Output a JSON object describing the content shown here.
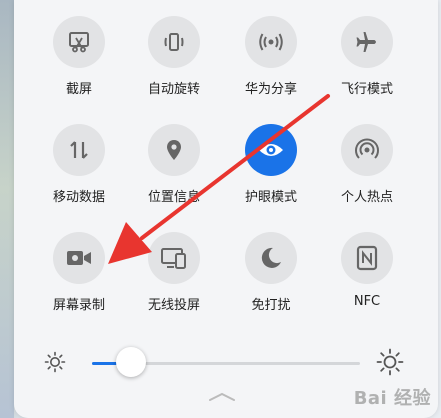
{
  "tiles": [
    {
      "label": "截屏",
      "icon": "screenshot-icon"
    },
    {
      "label": "自动旋转",
      "icon": "auto-rotate-icon"
    },
    {
      "label": "华为分享",
      "icon": "huawei-share-icon"
    },
    {
      "label": "飞行模式",
      "icon": "airplane-icon"
    },
    {
      "label": "移动数据",
      "icon": "mobile-data-icon"
    },
    {
      "label": "位置信息",
      "icon": "location-icon"
    },
    {
      "label": "护眼模式",
      "icon": "eye-comfort-icon",
      "active": true
    },
    {
      "label": "个人热点",
      "icon": "hotspot-icon"
    },
    {
      "label": "屏幕录制",
      "icon": "screen-record-icon"
    },
    {
      "label": "无线投屏",
      "icon": "wireless-projection-icon"
    },
    {
      "label": "免打扰",
      "icon": "do-not-disturb-icon"
    },
    {
      "label": "NFC",
      "icon": "nfc-icon"
    }
  ],
  "brightness": {
    "level": 0.13
  },
  "colors": {
    "accent": "#1a73e8",
    "arrow": "#e8352f",
    "tile_bg": "#e2e3e5"
  },
  "watermark": "Bai 经验"
}
